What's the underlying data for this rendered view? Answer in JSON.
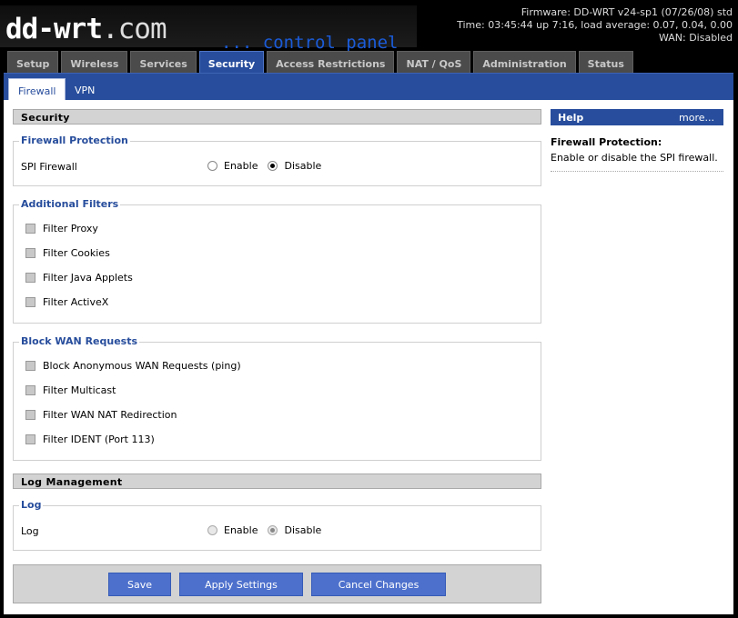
{
  "header": {
    "logo_main": "dd-wrt",
    "logo_com": ".com",
    "panel_title": "... control panel",
    "firmware": "Firmware: DD-WRT v24-sp1 (07/26/08) std",
    "time": "Time: 03:45:44 up 7:16, load average: 0.07, 0.04, 0.00",
    "wan": "WAN: Disabled"
  },
  "main_tabs": [
    "Setup",
    "Wireless",
    "Services",
    "Security",
    "Access Restrictions",
    "NAT / QoS",
    "Administration",
    "Status"
  ],
  "active_main_tab": "Security",
  "sub_tabs": [
    "Firewall",
    "VPN"
  ],
  "active_sub_tab": "Firewall",
  "security_section": {
    "title": "Security",
    "firewall_protection": {
      "legend": "Firewall Protection",
      "spi_label": "SPI Firewall",
      "enable_label": "Enable",
      "disable_label": "Disable",
      "selected": "Disable"
    },
    "additional_filters": {
      "legend": "Additional Filters",
      "items": [
        "Filter Proxy",
        "Filter Cookies",
        "Filter Java Applets",
        "Filter ActiveX"
      ]
    },
    "block_wan": {
      "legend": "Block WAN Requests",
      "items": [
        "Block Anonymous WAN Requests (ping)",
        "Filter Multicast",
        "Filter WAN NAT Redirection",
        "Filter IDENT (Port 113)"
      ]
    }
  },
  "log_section": {
    "title": "Log Management",
    "legend": "Log",
    "log_label": "Log",
    "enable_label": "Enable",
    "disable_label": "Disable",
    "selected": "Disable"
  },
  "help": {
    "title": "Help",
    "more": "more...",
    "topic": "Firewall Protection:",
    "text": "Enable or disable the SPI firewall."
  },
  "buttons": {
    "save": "Save",
    "apply": "Apply Settings",
    "cancel": "Cancel Changes"
  },
  "colors": {
    "accent_blue": "#274d9c",
    "button_blue": "#4d70cc",
    "section_gray": "#d3d3d3"
  }
}
